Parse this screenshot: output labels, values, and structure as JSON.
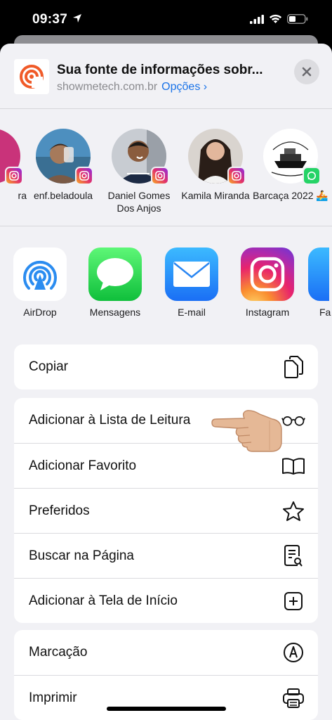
{
  "status": {
    "time": "09:37"
  },
  "header": {
    "title": "Sua fonte de informações sobr...",
    "domain": "showmetech.com.br",
    "options_label": "Opções ›"
  },
  "people": [
    {
      "name": "ra"
    },
    {
      "name": "enf.beladoula"
    },
    {
      "name": "Daniel Gomes Dos Anjos"
    },
    {
      "name": "Kamila Miranda"
    },
    {
      "name": "Barcaça 2022 🚣"
    }
  ],
  "apps": [
    {
      "label": "AirDrop",
      "icon": "airdrop-icon"
    },
    {
      "label": "Mensagens",
      "icon": "messages-icon"
    },
    {
      "label": "E-mail",
      "icon": "mail-icon"
    },
    {
      "label": "Instagram",
      "icon": "instagram-icon"
    },
    {
      "label": "Fa"
    }
  ],
  "actions": {
    "copy": "Copiar",
    "group2": [
      {
        "label": "Adicionar à Lista de Leitura",
        "icon": "glasses-icon"
      },
      {
        "label": "Adicionar Favorito",
        "icon": "book-icon"
      },
      {
        "label": "Preferidos",
        "icon": "star-icon"
      },
      {
        "label": "Buscar na Página",
        "icon": "find-in-page-icon"
      },
      {
        "label": "Adicionar à Tela de Início",
        "icon": "add-square-icon"
      }
    ],
    "group3": [
      {
        "label": "Marcação",
        "icon": "markup-icon"
      },
      {
        "label": "Imprimir",
        "icon": "print-icon"
      }
    ]
  }
}
